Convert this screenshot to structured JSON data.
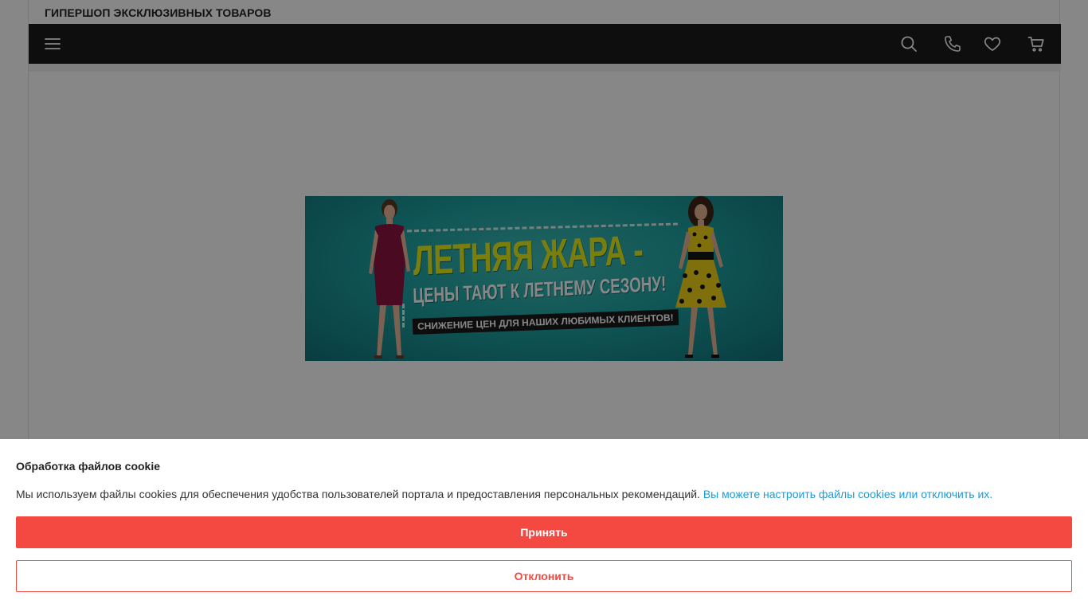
{
  "header": {
    "shop_title": "ГИПЕРШОП ЭКСКЛЮЗИВНЫХ ТОВАРОВ"
  },
  "navbar": {
    "icons": [
      "menu-icon",
      "search-icon",
      "phone-icon",
      "heart-icon",
      "cart-icon"
    ],
    "background": "#1c1c1c"
  },
  "banner": {
    "headline": "ЛЕТНЯЯ ЖАРА -",
    "subline": "ЦЕНЫ ТАЮТ К ЛЕТНЕМУ СЕЗОНУ!",
    "tagline": "СНИЖЕНИЕ ЦЕН ДЛЯ НАШИХ ЛЮБИМЫХ КЛИЕНТОВ!",
    "colors": {
      "headline": "#e6ef1c",
      "background": "#1fa3a3"
    }
  },
  "cookie": {
    "title": "Обработка файлов cookie",
    "text": "Мы используем файлы cookies для обеспечения удобства пользователей портала и предоставления персональных рекомендаций.",
    "link_text": "Вы можете настроить файлы cookies или отключить их.",
    "accept_label": "Принять",
    "decline_label": "Отклонить",
    "colors": {
      "accent": "#f44941",
      "link": "#1d9ad6"
    }
  }
}
